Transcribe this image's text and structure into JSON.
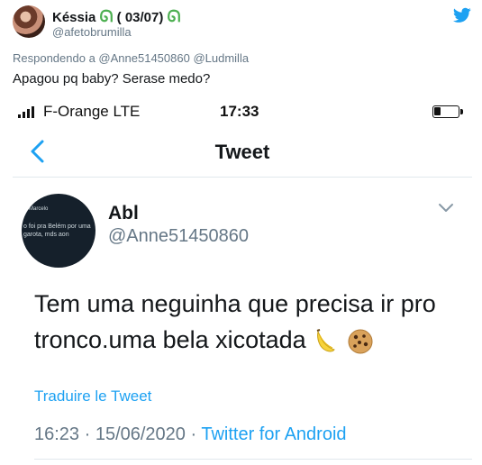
{
  "outer": {
    "name": "Késsia",
    "badge_emoji": "ᘏ",
    "name_date": " ( 03/07) ",
    "handle": "@afetobrumilla",
    "reply_prefix": "Respondendo a ",
    "reply_mention_1": "@Anne51450860",
    "reply_mention_2": "@Ludmilla",
    "text": "Apagou pq baby? Serase medo?"
  },
  "phone": {
    "carrier": "F-Orange  LTE",
    "time": "17:33",
    "nav_title": "Tweet",
    "avatar_text_1": "Marcelo",
    "avatar_text_2": "o foi pra Belém por uma garota, mds aon",
    "tweet_name": "Abl",
    "tweet_handle": "@Anne51450860",
    "tweet_text_line1": "Tem uma neguinha que precisa ir pro",
    "tweet_text_line2": "tronco.uma bela xicotada ",
    "translate": "Traduire le Tweet",
    "timestamp": "16:23 · 15/06/2020 · ",
    "source": "Twitter for Android"
  },
  "colors": {
    "twitter_blue": "#1da1f2",
    "secondary_text": "#657786",
    "badge_green": "#4caf50"
  }
}
